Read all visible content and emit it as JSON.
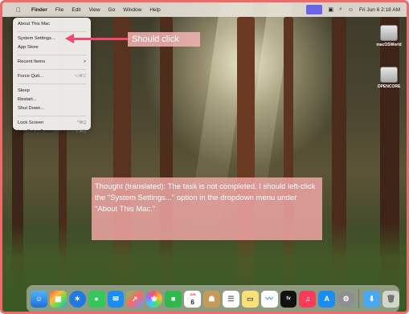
{
  "menubar": {
    "apple_icon": "apple-logo-icon",
    "items": [
      "Finder",
      "File",
      "Edit",
      "View",
      "Go",
      "Window",
      "Help"
    ],
    "clock": "Fri Jun 6  2:18 AM"
  },
  "apple_menu": {
    "items": [
      {
        "label": "About This Mac",
        "shortcut": ""
      },
      {
        "label": "System Settings...",
        "shortcut": ""
      },
      {
        "label": "App Store",
        "shortcut": ""
      },
      {
        "label": "Recent Items",
        "shortcut": ">"
      },
      {
        "label": "Force Quit...",
        "shortcut": "⌥⌘⎋"
      },
      {
        "label": "Sleep",
        "shortcut": ""
      },
      {
        "label": "Restart...",
        "shortcut": ""
      },
      {
        "label": "Shut Down...",
        "shortcut": ""
      },
      {
        "label": "Lock Screen",
        "shortcut": "^⌘Q"
      },
      {
        "label": "Log Out ec2-user...",
        "shortcut": "⇧⌘Q"
      }
    ]
  },
  "annotation": {
    "click_label": "Should click",
    "thought": "Thought (translated): The task is not completed. I should left-click the \"System Settings...\" option in the dropdown menu under \"About This Mac.\"",
    "accent": "#f5466e"
  },
  "desktop_icons": [
    {
      "label": "macOSWorld"
    },
    {
      "label": "OPENCORE"
    }
  ],
  "dock": {
    "calendar_day": "6",
    "calendar_month": "JUN",
    "tv_label": "tv"
  }
}
